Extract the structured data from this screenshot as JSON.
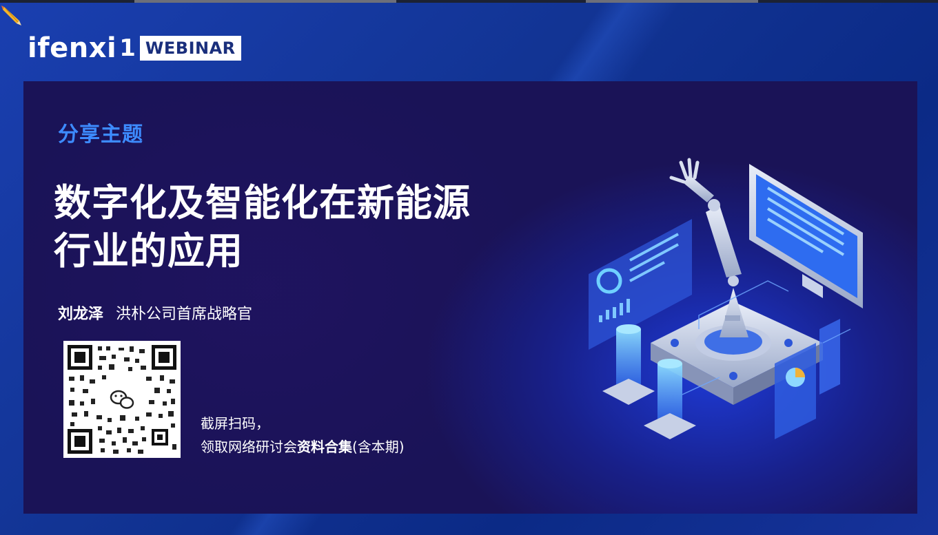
{
  "logo": {
    "brand_text": "ifenxi",
    "suffix": "1",
    "badge_text": "WEBINAR"
  },
  "slide": {
    "section_label": "分享主题",
    "title_line1": "数字化及智能化在新能源",
    "title_line2": "行业的应用",
    "speaker_name": "刘龙泽",
    "speaker_role": "洪朴公司首席战略官",
    "caption_line1": "截屏扫码，",
    "caption_line2_prefix": "领取网络研讨会",
    "caption_line2_bold": "资料合集",
    "caption_line2_suffix": "(含本期)"
  },
  "icons": {
    "pencil": "pencil-icon",
    "qr": "qr-code-icon",
    "wechat": "wechat-icon",
    "robot_illustration": "robot-arm-illustration"
  },
  "colors": {
    "accent_blue": "#3d8bff",
    "panel_bg": "#1a1357",
    "frame_bg": "#123494"
  }
}
